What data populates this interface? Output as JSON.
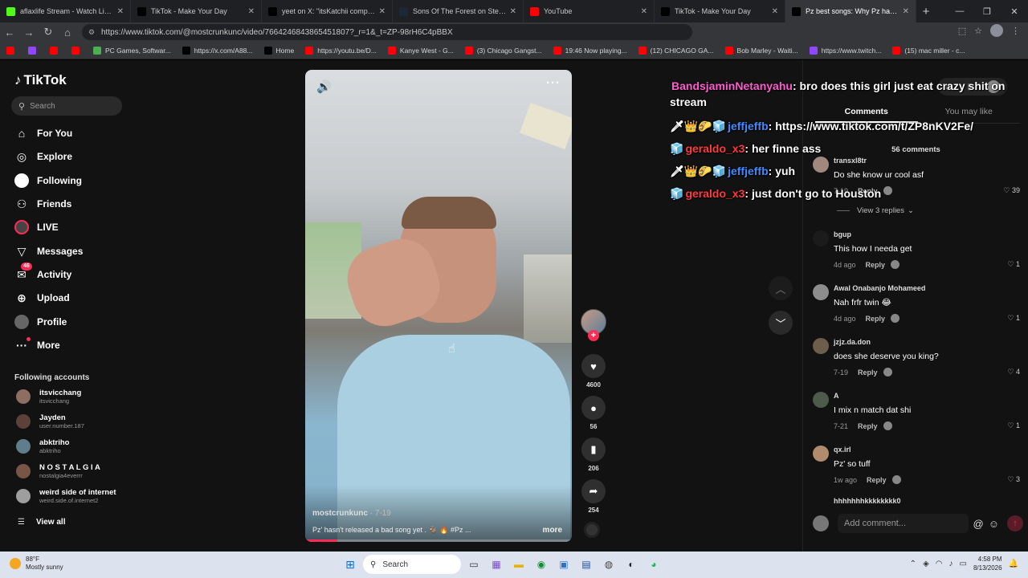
{
  "browser": {
    "tabs": [
      {
        "title": "aflaxlife Stream - Watch Live on K",
        "icon": "kick-icon",
        "color": "#53fc18",
        "active": false
      },
      {
        "title": "TikTok - Make Your Day",
        "icon": "tiktok-icon",
        "color": "#000000",
        "active": false
      },
      {
        "title": "yeet on X: \"itsKatchii completes th",
        "icon": "x-icon",
        "color": "#000000",
        "active": false
      },
      {
        "title": "Sons Of The Forest on Steam",
        "icon": "steam-icon",
        "color": "#1b2838",
        "active": false
      },
      {
        "title": "YouTube",
        "icon": "youtube-icon",
        "color": "#ff0000",
        "active": false
      },
      {
        "title": "TikTok - Make Your Day",
        "icon": "tiktok-icon",
        "color": "#000000",
        "active": false
      },
      {
        "title": "Pz best songs: Why Pz hasn't",
        "icon": "tiktok-icon",
        "color": "#000000",
        "active": true
      }
    ],
    "url": "https://www.tiktok.com/@mostcrunkunc/video/7664246843865451807?_r=1&_t=ZP-98rH6C4pBBX",
    "bookmarks": [
      {
        "label": "",
        "color": "#ff0000"
      },
      {
        "label": "",
        "color": "#9146ff"
      },
      {
        "label": "",
        "color": "#ff0000"
      },
      {
        "label": "",
        "color": "#ff0000"
      },
      {
        "label": "PC Games, Softwar...",
        "color": "#4caf50"
      },
      {
        "label": "https://x.com/A88...",
        "color": "#000000"
      },
      {
        "label": "Home",
        "color": "#000000"
      },
      {
        "label": "https://youtu.be/D...",
        "color": "#ff0000"
      },
      {
        "label": "Kanye West - G...",
        "color": "#ff0000"
      },
      {
        "label": "(3) Chicago Gangst...",
        "color": "#ff0000"
      },
      {
        "label": "19:46 Now playing...",
        "color": "#ff0000"
      },
      {
        "label": "(12) CHICAGO GA...",
        "color": "#ff0000"
      },
      {
        "label": "Bob Marley - Waiti...",
        "color": "#ff0000"
      },
      {
        "label": "https://www.twitch...",
        "color": "#9146ff"
      },
      {
        "label": "(15) mac miller - c...",
        "color": "#ff0000"
      }
    ]
  },
  "tiktok": {
    "logo": "TikTok",
    "search_placeholder": "Search",
    "nav": [
      {
        "label": "For You",
        "icon": "home-icon"
      },
      {
        "label": "Explore",
        "icon": "compass-icon"
      },
      {
        "label": "Following",
        "icon": "following-icon"
      },
      {
        "label": "Friends",
        "icon": "friends-icon"
      },
      {
        "label": "LIVE",
        "icon": "live-icon"
      },
      {
        "label": "Messages",
        "icon": "messages-icon"
      },
      {
        "label": "Activity",
        "icon": "activity-icon",
        "badge": "46"
      },
      {
        "label": "Upload",
        "icon": "upload-icon"
      },
      {
        "label": "Profile",
        "icon": "profile-icon"
      },
      {
        "label": "More",
        "icon": "more-icon"
      }
    ],
    "following_title": "Following accounts",
    "following": [
      {
        "name": "itsvicchang",
        "handle": "itsvicchang"
      },
      {
        "name": "Jayden",
        "handle": "user.number.187"
      },
      {
        "name": "abktriho",
        "handle": "abktriho"
      },
      {
        "name": "N O S T A L G I A",
        "handle": "nostalgia4everrr"
      },
      {
        "name": "weird side of internet",
        "handle": "weird.side.of.internet2"
      }
    ],
    "view_all": "View all",
    "video": {
      "author": "mostcrunkunc",
      "date": " · 7-19",
      "description": "Pz' hasn't released a bad song yet . 🐐 🔥 #Pz ...",
      "more": "more",
      "progress": 0.12
    },
    "actions": {
      "likes": "4600",
      "comments": "56",
      "saves": "206",
      "shares": "254"
    },
    "comments_panel": {
      "tabs": [
        "Comments",
        "You may like"
      ],
      "count": "56 comments",
      "items": [
        {
          "user": "transxl8tr",
          "text": "Do she know ur cool asf",
          "time": "7-19",
          "likes": "39"
        },
        {
          "user": "bgup",
          "text": "This how I needa get",
          "time": "4d ago",
          "likes": "1"
        },
        {
          "user": "Awal Onabanjo Mohameed",
          "text": "Nah frfr twin 😂",
          "time": "4d ago",
          "likes": "1"
        },
        {
          "user": "jzjz.da.don",
          "text": "does she deserve you king?",
          "time": "7-19",
          "likes": "4"
        },
        {
          "user": "A",
          "text": "I mix n match dat shi",
          "time": "7-21",
          "likes": "1"
        },
        {
          "user": "qx.irl",
          "text": "Pz' so tuff",
          "time": "1w ago",
          "likes": "3"
        }
      ],
      "reply_label": "Reply",
      "view_replies": "View 3 replies",
      "partial_user": "hhhhhhhkkkkkkkk0",
      "add_placeholder": "Add comment..."
    }
  },
  "chat": [
    {
      "user": "BandsjaminNetanyahu",
      "color": "#ff5cd1",
      "badges": "",
      "message": "bro does this girl just eat crazy shit on stream"
    },
    {
      "user": "jeffjeffb",
      "color": "#3d8bff",
      "badges": "🗡👑🌮🧊",
      "message": "https://www.tiktok.com/t/ZP8nKV2Fe/"
    },
    {
      "user": "geraldo_x3",
      "color": "#ff3b3b",
      "badges": "🧊",
      "message": "her finne ass"
    },
    {
      "user": "jeffjeffb",
      "color": "#3d8bff",
      "badges": "🗡👑🌮🧊",
      "message": "yuh"
    },
    {
      "user": "geraldo_x3",
      "color": "#ff3b3b",
      "badges": "🧊",
      "message": "just don't go to Houston"
    }
  ],
  "taskbar": {
    "temp": "88°F",
    "weather": "Mostly sunny",
    "search": "Search",
    "time": "4:58 PM",
    "date": "8/13/2026"
  }
}
